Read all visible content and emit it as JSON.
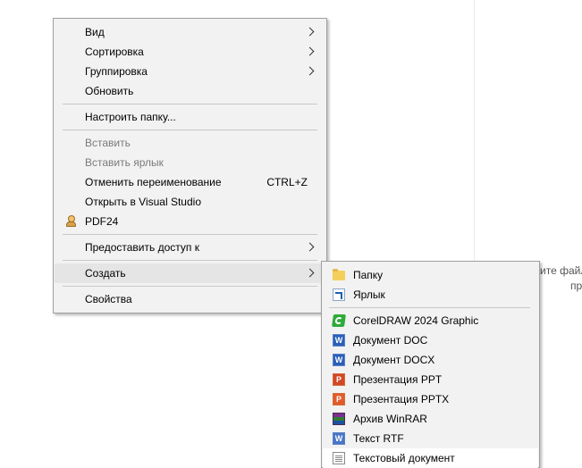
{
  "side_panel": {
    "text_line1": "ите файл",
    "text_line2": "пр"
  },
  "context_menu": {
    "items": [
      {
        "label": "Вид",
        "has_submenu": true
      },
      {
        "label": "Сортировка",
        "has_submenu": true
      },
      {
        "label": "Группировка",
        "has_submenu": true
      },
      {
        "label": "Обновить"
      },
      {
        "label": "Настроить папку..."
      },
      {
        "label": "Вставить",
        "disabled": true
      },
      {
        "label": "Вставить ярлык",
        "disabled": true
      },
      {
        "label": "Отменить переименование",
        "shortcut": "CTRL+Z"
      },
      {
        "label": "Открыть в Visual Studio"
      },
      {
        "label": "PDF24",
        "icon": "pdf24-icon"
      },
      {
        "label": "Предоставить доступ к",
        "has_submenu": true
      },
      {
        "label": "Создать",
        "has_submenu": true,
        "highlighted": true
      },
      {
        "label": "Свойства"
      }
    ]
  },
  "create_submenu": {
    "items": [
      {
        "label": "Папку",
        "icon": "folder-icon"
      },
      {
        "label": "Ярлык",
        "icon": "shortcut-icon"
      },
      {
        "label": "CorelDRAW 2024 Graphic",
        "icon": "coreldraw-icon"
      },
      {
        "label": "Документ DOC",
        "icon": "word-doc-icon"
      },
      {
        "label": "Документ DOCX",
        "icon": "word-docx-icon"
      },
      {
        "label": "Презентация PPT",
        "icon": "powerpoint-ppt-icon"
      },
      {
        "label": "Презентация PPTX",
        "icon": "powerpoint-pptx-icon"
      },
      {
        "label": "Архив WinRAR",
        "icon": "winrar-archive-icon"
      },
      {
        "label": "Текст RTF",
        "icon": "rtf-document-icon"
      },
      {
        "label": "Текстовый документ",
        "icon": "text-document-icon"
      }
    ]
  },
  "colors": {
    "menu_background": "#f2f2f2",
    "menu_border": "#a0a0a0",
    "highlight": "#e5e5e5",
    "disabled_text": "#7a7a7a"
  }
}
